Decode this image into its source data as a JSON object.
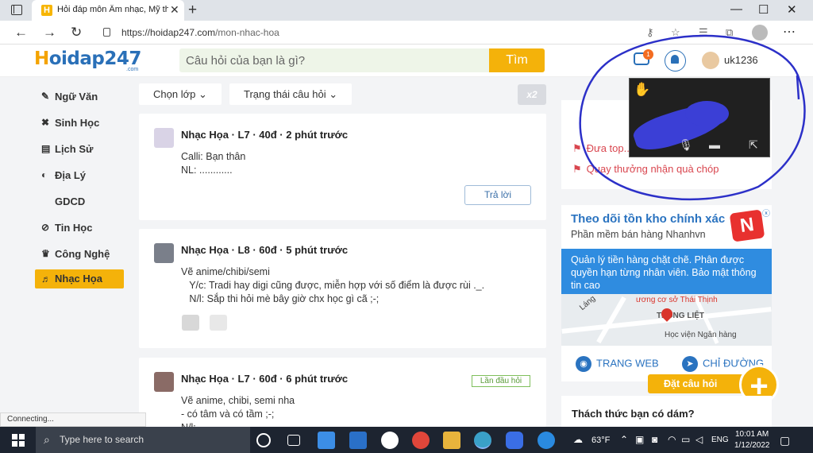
{
  "browser": {
    "tab_title": "Hỏi đáp môn Âm nhạc, Mỹ thuật",
    "tab_favicon": "H",
    "new_tab": "+",
    "url_domain": "https://hoidap247.com",
    "url_path": "/mon-nhac-hoa",
    "minimize": "—",
    "maximize": "☐",
    "close": "✕"
  },
  "header": {
    "logo_h": "H",
    "logo_rest": "oidap247",
    "logo_suffix": ".com",
    "search_placeholder": "Câu hỏi của bạn là gì?",
    "search_button": "Tìm",
    "message_badge": "1",
    "username": "uk1236"
  },
  "sidebar": {
    "items": [
      {
        "icon": "✎",
        "label": "Ngữ Văn"
      },
      {
        "icon": "✖",
        "label": "Sinh Học"
      },
      {
        "icon": "▤",
        "label": "Lịch Sử"
      },
      {
        "icon": "◐",
        "label": "Địa Lý"
      },
      {
        "icon": "",
        "label": "GDCD"
      },
      {
        "icon": "⊘",
        "label": "Tin Học"
      },
      {
        "icon": "♛",
        "label": "Công Nghệ"
      },
      {
        "icon": "♬",
        "label": "Nhạc Họa"
      }
    ]
  },
  "filters": {
    "grade": "Chọn lớp",
    "status": "Trạng thái câu hỏi",
    "x2": "x2"
  },
  "questions": [
    {
      "subject": "Nhạc Họa",
      "grade": "L7",
      "points": "40đ",
      "time": "2 phút trước",
      "body": "Calli: Bạn thân\nNL: ............",
      "answer": "Trả lời"
    },
    {
      "subject": "Nhạc Họa",
      "grade": "L8",
      "points": "60đ",
      "time": "5 phút trước",
      "body": "Vẽ anime/chibi/semi\n   Y/c: Tradi hay digi cũng được, miễn hợp với số điểm là được rùi ._.\n   N/l: Sắp thi hỏi mè bây giờ chx học gì cã ;-;"
    },
    {
      "subject": "Nhạc Họa",
      "grade": "L7",
      "points": "60đ",
      "time": "6 phút trước",
      "first_tag": "Lần đầu hỏi",
      "body": "Vẽ anime, chibi, semi nha\n- có tâm và có tầm ;-;\nN/l: ..."
    }
  ],
  "right": {
    "flag1": "Đưa top...",
    "flag2": "Quay thưởng nhận quà chóp"
  },
  "ad": {
    "title": "Theo dõi tồn kho chính xác",
    "subtitle": "Phần mềm bán hàng Nhanhvn",
    "logo": "N",
    "close": "ⓧ",
    "blue_text": "Quản lý tiền hàng chặt chẽ. Phân được quyền hạn từng nhân viên. Bảo mật thông tin cao",
    "map_label1": "ương cơ sở Thái Thịnh",
    "map_label2": "TRUNG LIỆT",
    "map_label3": "Học viện Ngân hàng",
    "map_label4": "Láng",
    "web_button": "TRANG WEB",
    "direction_button": "CHỈ ĐƯỜNG"
  },
  "ask": {
    "label": "Đặt câu hỏi",
    "plus": "+"
  },
  "challenge": {
    "title": "Thách thức bạn có dám?"
  },
  "status_bar": "Connecting...",
  "taskbar": {
    "search": "Type here to search",
    "weather": "63°F",
    "lang": "ENG",
    "time": "10:01 AM",
    "date": "1/12/2022"
  }
}
